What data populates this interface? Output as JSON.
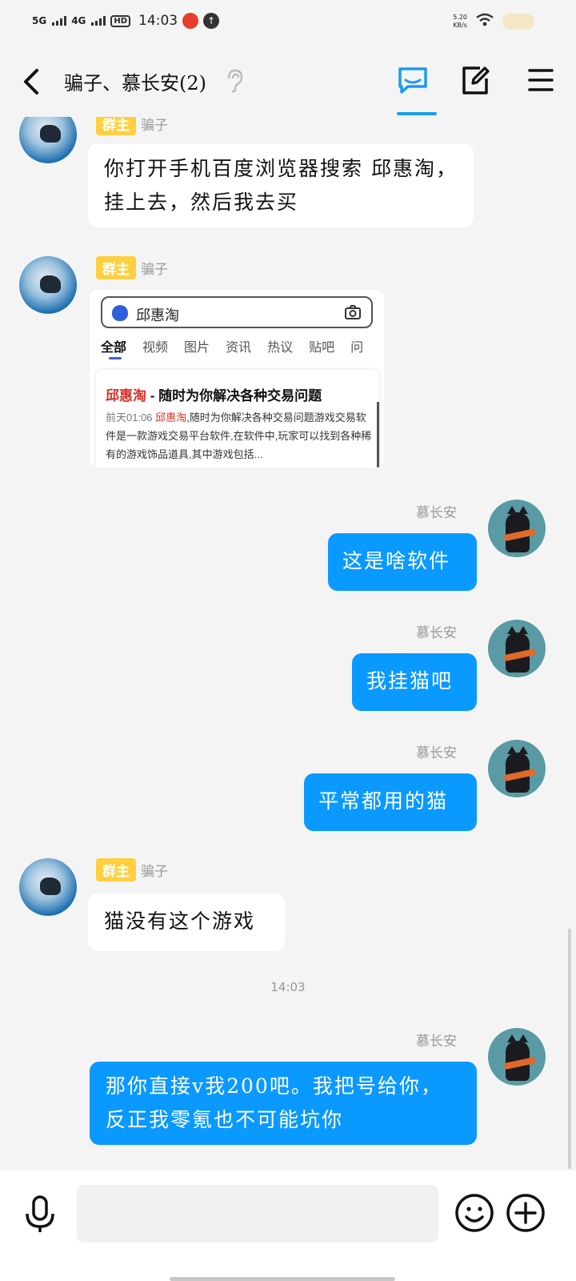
{
  "status_bar": {
    "net1": "5G",
    "net2": "4G",
    "hd": "HD",
    "time": "14:03",
    "speed_value": "5.20",
    "speed_unit": "KB/s"
  },
  "header": {
    "title": "骗子、慕长安(2)"
  },
  "messages": [
    {
      "badge": "群主",
      "sender": "骗子",
      "text": "你打开手机百度浏览器搜索  邱惠淘，挂上去，然后我去买"
    },
    {
      "badge": "群主",
      "sender": "骗子"
    },
    {
      "sender": "慕长安",
      "text": "这是啥软件"
    },
    {
      "sender": "慕长安",
      "text": "我挂猫吧"
    },
    {
      "sender": "慕长安",
      "text": "平常都用的猫"
    },
    {
      "badge": "群主",
      "sender": "骗子",
      "text": "猫没有这个游戏"
    },
    {
      "sender": "慕长安",
      "text": "那你直接v我200吧。我把号给你，反正我零氪也不可能坑你"
    }
  ],
  "image_card": {
    "search_query": "邱惠淘",
    "tabs": [
      "全部",
      "视频",
      "图片",
      "资讯",
      "热议",
      "贴吧",
      "问"
    ],
    "result_title_name": "邱惠淘",
    "result_title_rest": " - 随时为你解决各种交易问题",
    "result_date": "前天01:06",
    "result_name": "邱惠淘",
    "result_desc": ",随时为你解决各种交易问题游戏交易软件是一款游戏交易平台软件,在软件中,玩家可以找到各种稀有的游戏饰品道具,其中游戏包括..."
  },
  "timestamp": "14:03",
  "colors": {
    "accent": "#1a9cf0",
    "bubble_blue": "#0a99ff",
    "badge_yellow": "#ffcf3f"
  },
  "icons": {
    "back": "chevron-left-icon",
    "chat": "chat-bubble-icon",
    "edit": "edit-note-icon",
    "menu": "hamburger-icon",
    "mic": "microphone-icon",
    "emoji": "smiley-icon",
    "plus": "plus-circle-icon"
  }
}
